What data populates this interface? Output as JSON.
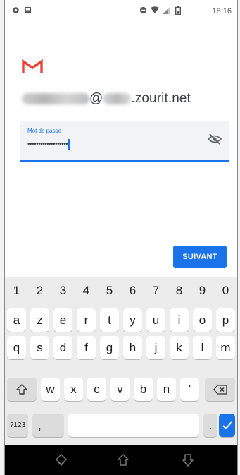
{
  "status_bar": {
    "time": "18:16",
    "left_icons": [
      "settings-icon",
      "image-icon"
    ],
    "right_icons": [
      "do-not-disturb-icon",
      "wifi-icon",
      "signal-icon",
      "battery-icon"
    ]
  },
  "login": {
    "logo": "gmail-logo",
    "email_suffix": "@",
    "email_domain": ".zourit.net",
    "password_label": "Mot de passe",
    "password_value": "•••••••••••••••••••",
    "toggle_icon": "eye-off-icon",
    "next_label": "SUIVANT",
    "accent_color": "#1a73e8"
  },
  "keyboard": {
    "number_row": [
      "1",
      "2",
      "3",
      "4",
      "5",
      "6",
      "7",
      "8",
      "9",
      "0"
    ],
    "row1": [
      "a",
      "z",
      "e",
      "r",
      "t",
      "y",
      "u",
      "i",
      "o",
      "p"
    ],
    "row2": [
      "q",
      "s",
      "d",
      "f",
      "g",
      "h",
      "j",
      "k",
      "l",
      "m"
    ],
    "row3": [
      "w",
      "x",
      "c",
      "v",
      "b",
      "n",
      "'"
    ],
    "symbols_label": "?123",
    "comma": ",",
    "period": "."
  },
  "nav_bar": {
    "icons": [
      "hide-keyboard-icon",
      "home-icon",
      "recents-icon"
    ]
  }
}
